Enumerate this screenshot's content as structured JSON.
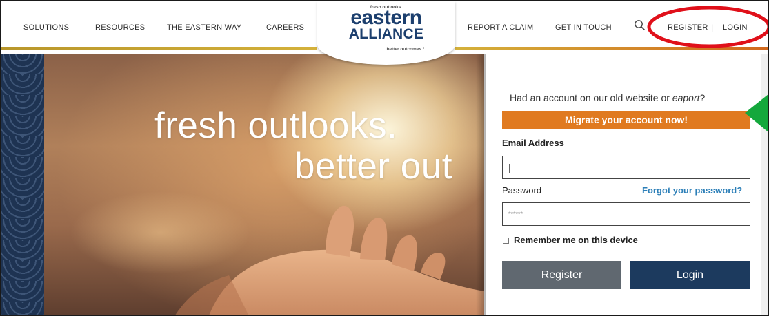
{
  "header": {
    "nav": {
      "solutions": "SOLUTIONS",
      "resources": "RESOURCES",
      "eastern_way": "THE EASTERN WAY",
      "careers": "CAREERS",
      "report_claim": "REPORT A CLAIM",
      "get_in_touch": "GET IN TOUCH",
      "register": "REGISTER",
      "separator": "|",
      "login": "LOGIN"
    },
    "search_icon": "search-icon",
    "logo": {
      "tagline": "fresh outlooks.",
      "name_line1": "eastern",
      "name_line2": "ALLIANCE",
      "subtag": "better outcomes.°"
    },
    "stripe_colors": [
      "#c9a227",
      "#c9a227",
      "#d2691e"
    ]
  },
  "hero": {
    "line1": "fresh outlooks.",
    "line2": "better out"
  },
  "login_panel": {
    "old_account_prefix": "Had an account on our old website or ",
    "old_account_italic": "eaport",
    "old_account_suffix": "?",
    "migrate_label": "Migrate your account now!",
    "email_label": "Email Address",
    "email_value": "|",
    "password_label": "Password",
    "forgot_label": "Forgot your password?",
    "password_value": "******",
    "remember_label": "Remember me on this device",
    "register_button": "Register",
    "login_button": "Login"
  },
  "colors": {
    "brand_navy": "#1c3a5e",
    "accent_orange": "#e07a20",
    "link_blue": "#2c7fb8",
    "annotation_red": "#e0101a",
    "annotation_green": "#14a83c"
  }
}
